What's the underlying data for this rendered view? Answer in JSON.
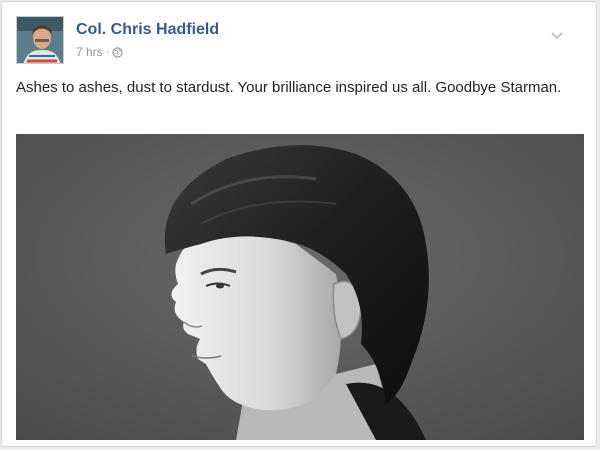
{
  "post": {
    "author_name": "Col. Chris Hadfield",
    "timestamp": "7 hrs",
    "separator": "·",
    "privacy_icon": "globe-icon",
    "options_icon": "chevron-down-icon",
    "text": "Ashes to ashes, dust to stardust. Your brilliance inspired us all. Goodbye Starman.",
    "photo_icon": "portrait-photo"
  },
  "colors": {
    "author_link": "#365899",
    "meta_text": "#90949c",
    "body_text": "#1d2129",
    "card_border": "#d3d6db"
  }
}
